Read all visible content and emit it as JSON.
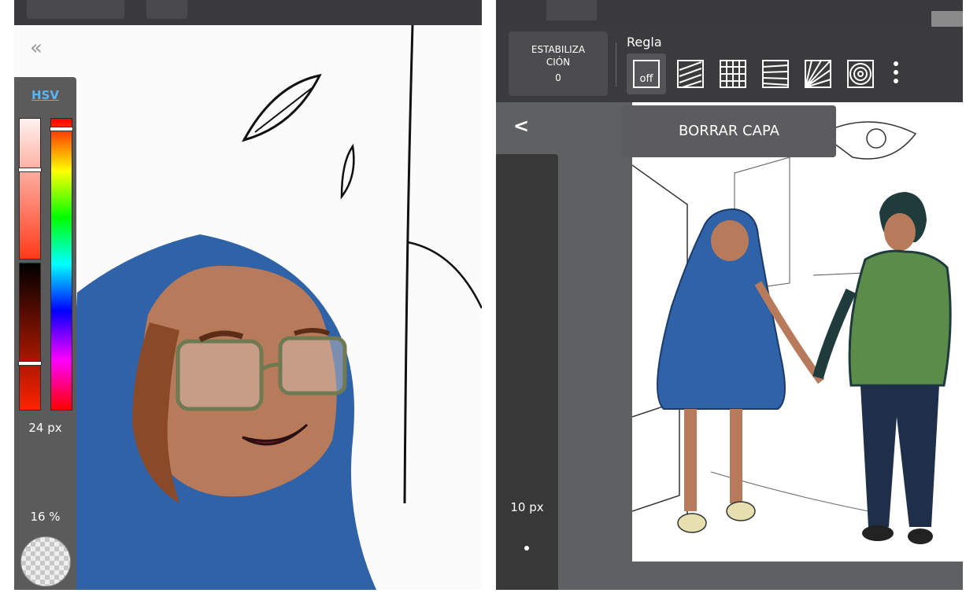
{
  "left_panel": {
    "color_panel": {
      "mode_label": "HSV",
      "brush_size": "24 px",
      "opacity": "16 %"
    }
  },
  "right_panel": {
    "stabilization": {
      "line1": "ESTABILIZA",
      "line2": "CIÓN",
      "value": "0"
    },
    "ruler": {
      "label": "Regla",
      "off_label": "off",
      "options": [
        "off-icon",
        "parallel-lines-icon",
        "grid-icon",
        "perspective-lines-icon",
        "vanishing-point-icon",
        "concentric-circles-icon"
      ]
    },
    "erase_layer_label": "BORRAR CAPA",
    "brush_size": "10 px"
  },
  "colors": {
    "accent": "#5fb4f0",
    "hood_blue": "#2f62a6",
    "jacket_green": "#5c8c4a",
    "jacket_dark": "#1f3b3c",
    "skin": "#b77a5a",
    "panel_dark": "#383839"
  }
}
